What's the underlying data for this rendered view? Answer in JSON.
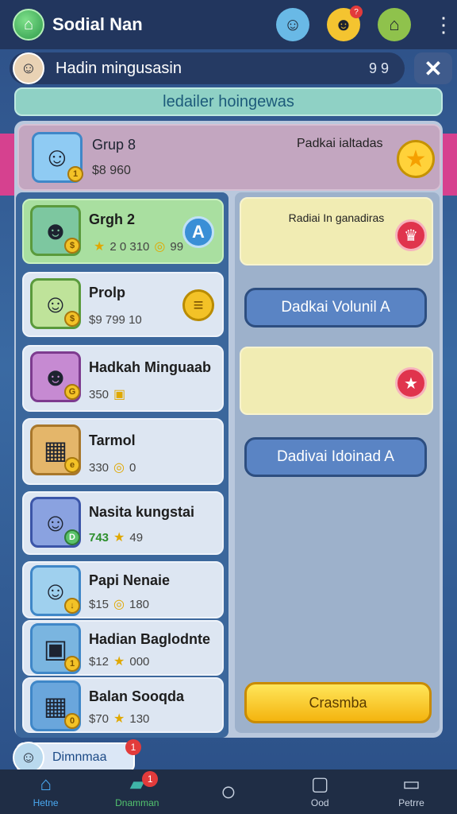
{
  "header": {
    "title": "Sodial Nan",
    "logo_icon": "house-icon",
    "avatars": [
      {
        "icon": "girl-avatar-icon",
        "badge": ""
      },
      {
        "icon": "boy-avatar-icon",
        "badge": "?"
      },
      {
        "icon": "pet-avatar-icon",
        "badge": ""
      }
    ]
  },
  "profile": {
    "name": "Hadin mingusasin",
    "count": "9 9",
    "close_icon": "close-icon"
  },
  "banner": {
    "text": "ledailer hoingewas"
  },
  "group": {
    "name": "Grup 8",
    "price": "$8 960",
    "heading": "Padkai ialtadas",
    "badge": "1"
  },
  "list": [
    {
      "name": "Grgh 2",
      "meta_a": "2",
      "meta_b": "0 310",
      "meta_c": "99",
      "action": "A",
      "selected": true,
      "badge": "$"
    },
    {
      "name": "Prolp",
      "meta_a": "$9",
      "meta_b": "799",
      "meta_c": "10",
      "action": "≡",
      "selected": false,
      "badge": "$"
    },
    {
      "name": "Hadkah Minguaab",
      "meta_a": "",
      "meta_b": "350",
      "meta_c": "",
      "action": "",
      "selected": false,
      "badge": "G"
    },
    {
      "name": "Tarmol",
      "meta_a": "",
      "meta_b": "330",
      "meta_c": "0",
      "action": "",
      "selected": false,
      "badge": "e"
    },
    {
      "name": "Nasita kungstai",
      "meta_a": "743",
      "meta_b": "",
      "meta_c": "49",
      "action": "",
      "selected": false,
      "badge": "D"
    },
    {
      "name": "Papi Nenaie",
      "meta_a": "$15",
      "meta_b": "",
      "meta_c": "180",
      "action": "",
      "selected": false,
      "badge": "↓"
    },
    {
      "name": "Hadian Baglodnte",
      "meta_a": "$12",
      "meta_b": "",
      "meta_c": "000",
      "action": "",
      "selected": false,
      "badge": "1"
    },
    {
      "name": "Balan Sooqda",
      "meta_a": "$70",
      "meta_b": "",
      "meta_c": "130",
      "action": "",
      "selected": false,
      "badge": "0"
    }
  ],
  "right": {
    "tile1_label": "Radiai In ganadiras",
    "pill1": "Dadkai Volunil A",
    "pill2": "Dadivai Idoinad A",
    "yellow_button": "Crasmba"
  },
  "chip": {
    "label": "Dimnmaa",
    "badge": "1"
  },
  "nav": [
    {
      "label": "Hetne",
      "icon": "home-icon",
      "badge": ""
    },
    {
      "label": "Dnamman",
      "icon": "cards-icon",
      "badge": "1"
    },
    {
      "label": "",
      "icon": "circle-icon",
      "badge": ""
    },
    {
      "label": "Ood",
      "icon": "square-icon",
      "badge": ""
    },
    {
      "label": "Petrre",
      "icon": "stack-icon",
      "badge": ""
    }
  ],
  "colors": {
    "background": "#3a6aa3",
    "accent_yellow": "#f4c430",
    "selected_card": "#a9dfa0",
    "red_button": "#e0344d"
  }
}
